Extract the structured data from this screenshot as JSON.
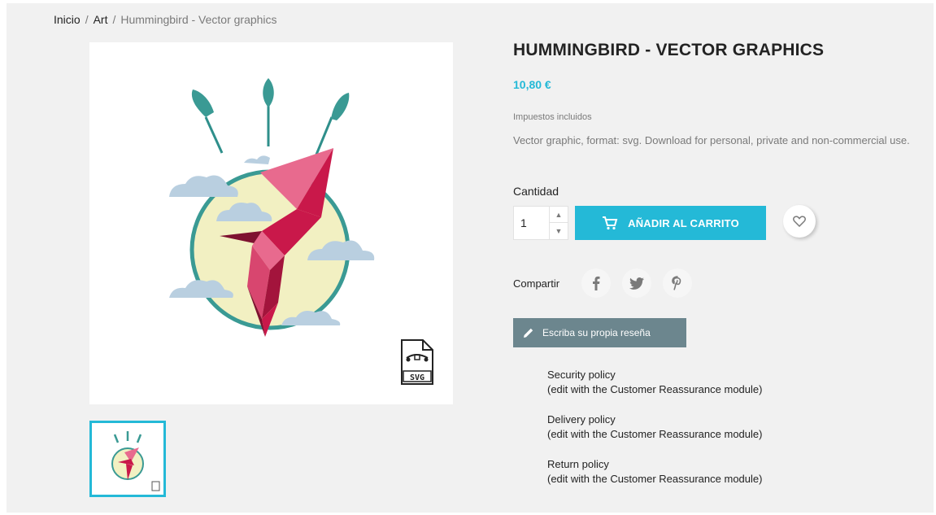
{
  "breadcrumb": {
    "items": [
      "Inicio",
      "Art"
    ],
    "separator": "/",
    "current": "Hummingbird - Vector graphics"
  },
  "product": {
    "title": "HUMMINGBIRD - VECTOR GRAPHICS",
    "price": "10,80 €",
    "tax_note": "Impuestos incluidos",
    "description": "Vector graphic, format: svg. Download for personal, private and non-commercial use.",
    "badge_text": "SVG"
  },
  "cart": {
    "quantity_label": "Cantidad",
    "quantity_value": "1",
    "add_label": "AÑADIR AL CARRITO"
  },
  "share": {
    "label": "Compartir",
    "networks": [
      "facebook-icon",
      "twitter-icon",
      "pinterest-icon"
    ]
  },
  "review": {
    "label": "Escriba su propia reseña"
  },
  "reassurance": [
    {
      "title": "Security policy",
      "note": "(edit with the Customer Reassurance module)"
    },
    {
      "title": "Delivery policy",
      "note": "(edit with the Customer Reassurance module)"
    },
    {
      "title": "Return policy",
      "note": "(edit with the Customer Reassurance module)"
    }
  ],
  "colors": {
    "accent": "#24b9d7",
    "review_button": "#6c868e",
    "page_bg": "#f1f1f1",
    "teal": "#3a9a94",
    "crimson": "#c9184a",
    "pink": "#e86a8e",
    "sun": "#f2f0c2",
    "cloud": "#b9cfe0"
  }
}
